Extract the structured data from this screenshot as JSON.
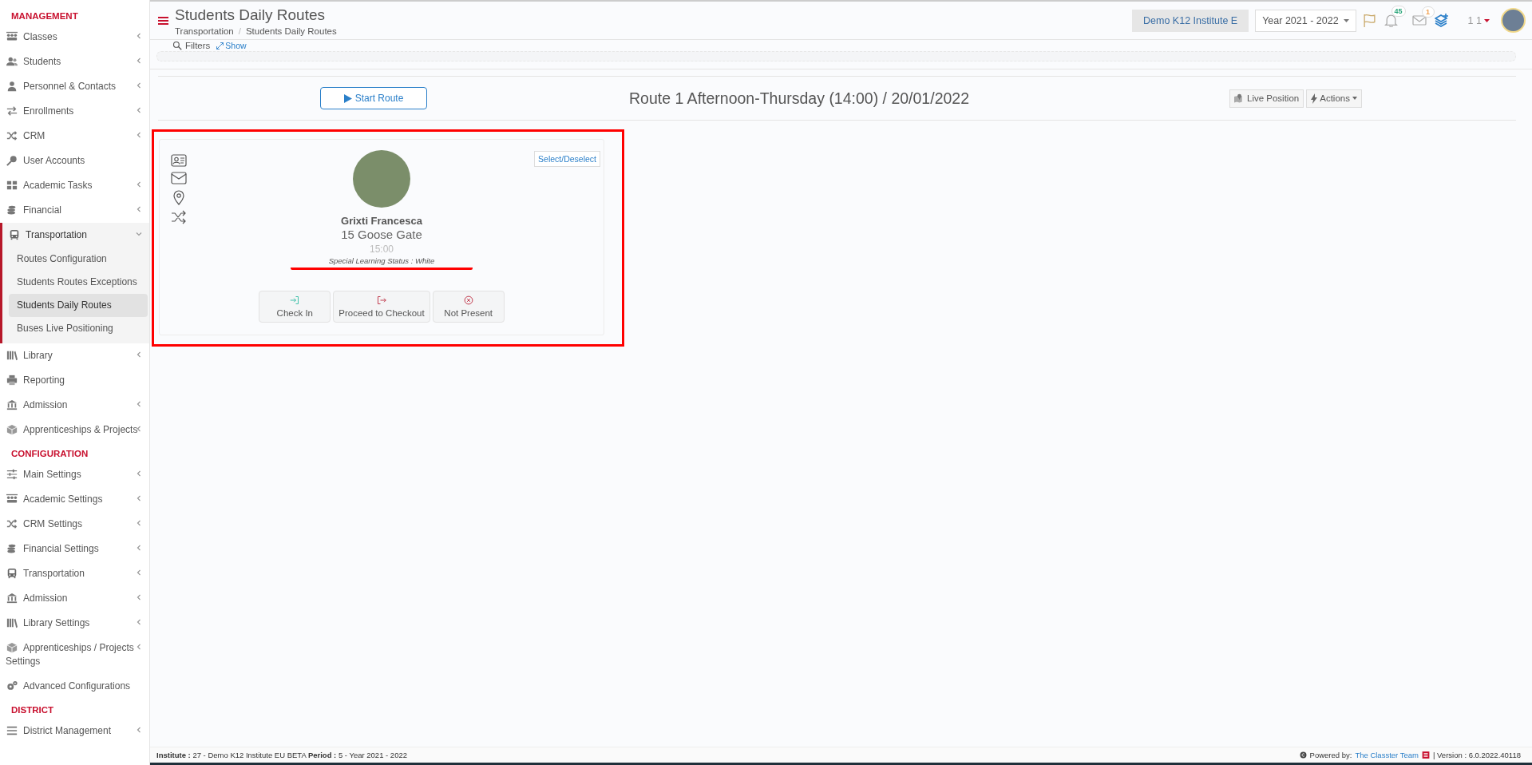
{
  "sidebar": {
    "sections": [
      {
        "title": "MANAGEMENT",
        "items": [
          {
            "label": "Classes",
            "submenu": true,
            "expanded": false
          },
          {
            "label": "Students",
            "submenu": true,
            "expanded": false
          },
          {
            "label": "Personnel & Contacts",
            "submenu": true,
            "expanded": false
          },
          {
            "label": "Enrollments",
            "submenu": true,
            "expanded": false
          },
          {
            "label": "CRM",
            "submenu": true,
            "expanded": false
          },
          {
            "label": "User Accounts",
            "submenu": false,
            "expanded": false
          },
          {
            "label": "Academic Tasks",
            "submenu": true,
            "expanded": false
          },
          {
            "label": "Financial",
            "submenu": true,
            "expanded": false
          },
          {
            "label": "Transportation",
            "submenu": true,
            "expanded": true,
            "children": [
              {
                "label": "Routes Configuration",
                "selected": false
              },
              {
                "label": "Students Routes Exceptions",
                "selected": false
              },
              {
                "label": "Students Daily Routes",
                "selected": true
              },
              {
                "label": "Buses Live Positioning",
                "selected": false
              }
            ]
          },
          {
            "label": "Library",
            "submenu": true,
            "expanded": false
          },
          {
            "label": "Reporting",
            "submenu": false,
            "expanded": false
          },
          {
            "label": "Admission",
            "submenu": true,
            "expanded": false
          },
          {
            "label": "Apprenticeships & Projects",
            "submenu": true,
            "expanded": false
          }
        ]
      },
      {
        "title": "CONFIGURATION",
        "items": [
          {
            "label": "Main Settings",
            "submenu": true,
            "expanded": false
          },
          {
            "label": "Academic Settings",
            "submenu": true,
            "expanded": false
          },
          {
            "label": "CRM Settings",
            "submenu": true,
            "expanded": false
          },
          {
            "label": "Financial Settings",
            "submenu": true,
            "expanded": false
          },
          {
            "label": "Transportation",
            "submenu": true,
            "expanded": false
          },
          {
            "label": "Admission",
            "submenu": true,
            "expanded": false
          },
          {
            "label": "Library Settings",
            "submenu": true,
            "expanded": false
          },
          {
            "label": "Apprenticeships / Projects Settings",
            "submenu": true,
            "expanded": false
          },
          {
            "label": "Advanced Configurations",
            "submenu": false,
            "expanded": false
          }
        ]
      },
      {
        "title": "DISTRICT",
        "items": [
          {
            "label": "District Management",
            "submenu": true,
            "expanded": false
          }
        ]
      }
    ]
  },
  "header": {
    "title": "Students Daily Routes",
    "breadcrumb": [
      "Transportation",
      "Students Daily Routes"
    ],
    "breadcrumb_separator": "/",
    "institute": "Demo K12 Institute E",
    "year": "Year 2021 - 2022",
    "notifications": "45",
    "messages": "1",
    "user": "1 1"
  },
  "filters": {
    "label": "Filters",
    "toggle": "Show"
  },
  "route": {
    "start_button": "Start Route",
    "title": "Route 1 Afternoon-Thursday (14:00) / 20/01/2022",
    "live_position": "Live Position",
    "actions": "Actions"
  },
  "card": {
    "highlighted": true,
    "select_button": "Select/Deselect",
    "name": "Grixti Francesca",
    "address": "15 Goose Gate",
    "time": "15:00",
    "status": "Special Learning Status : White",
    "status_underlined": true,
    "actions": [
      {
        "kind": "check_in",
        "label": "Check In"
      },
      {
        "kind": "checkout",
        "label": "Proceed to Checkout"
      },
      {
        "kind": "absent",
        "label": "Not Present"
      }
    ]
  },
  "footer": {
    "info": "**Institute :** 27 - Demo K12 Institute EU BETA **Period :** 5 - Year 2021 - 2022",
    "powered_by": "Powered by:",
    "team": "The Classter Team",
    "version": "| Version : 6.0.2022.40118"
  }
}
